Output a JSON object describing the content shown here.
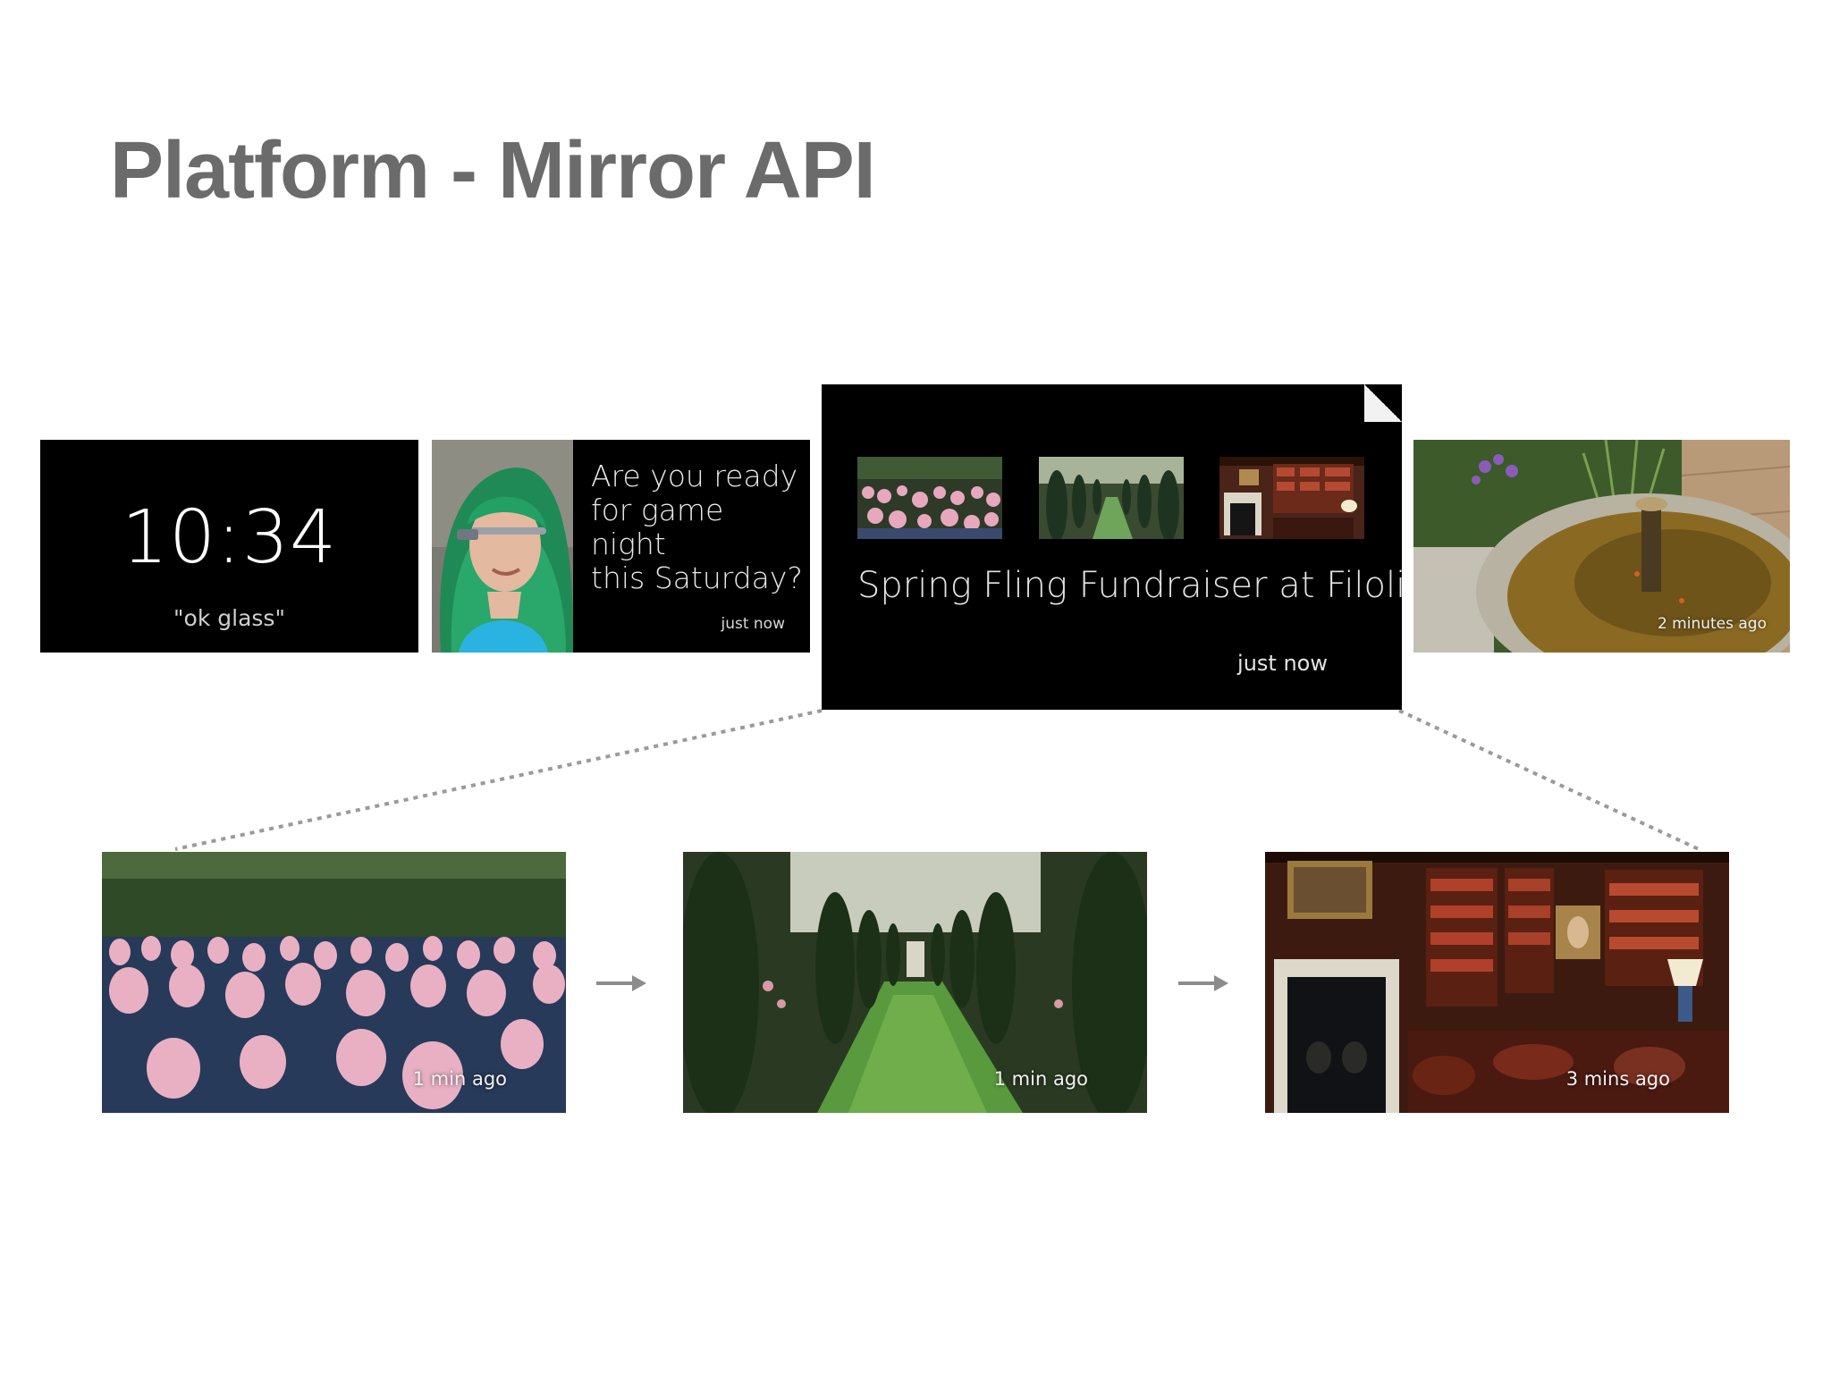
{
  "slide": {
    "title": "Platform - Mirror API"
  },
  "cards": {
    "clock": {
      "time": "10:34",
      "hint": "\"ok glass\""
    },
    "message": {
      "text_lines": [
        "Are you ready",
        "for game night",
        "this Saturday?"
      ],
      "timestamp": "just now"
    },
    "bundle": {
      "title": "Spring Fling Fundraiser at Filoli",
      "timestamp": "just now"
    },
    "photo": {
      "timestamp": "2 minutes ago"
    }
  },
  "expanded": [
    {
      "timestamp": "1 min ago"
    },
    {
      "timestamp": "1 min ago"
    },
    {
      "timestamp": "3 mins ago"
    }
  ],
  "colors": {
    "title": "#6b6b6b",
    "card_bg": "#000000",
    "connector": "#9a9a9a",
    "arrow": "#8c8c8c"
  },
  "icons": [
    "arrow-right-icon",
    "bundle-corner-icon"
  ]
}
